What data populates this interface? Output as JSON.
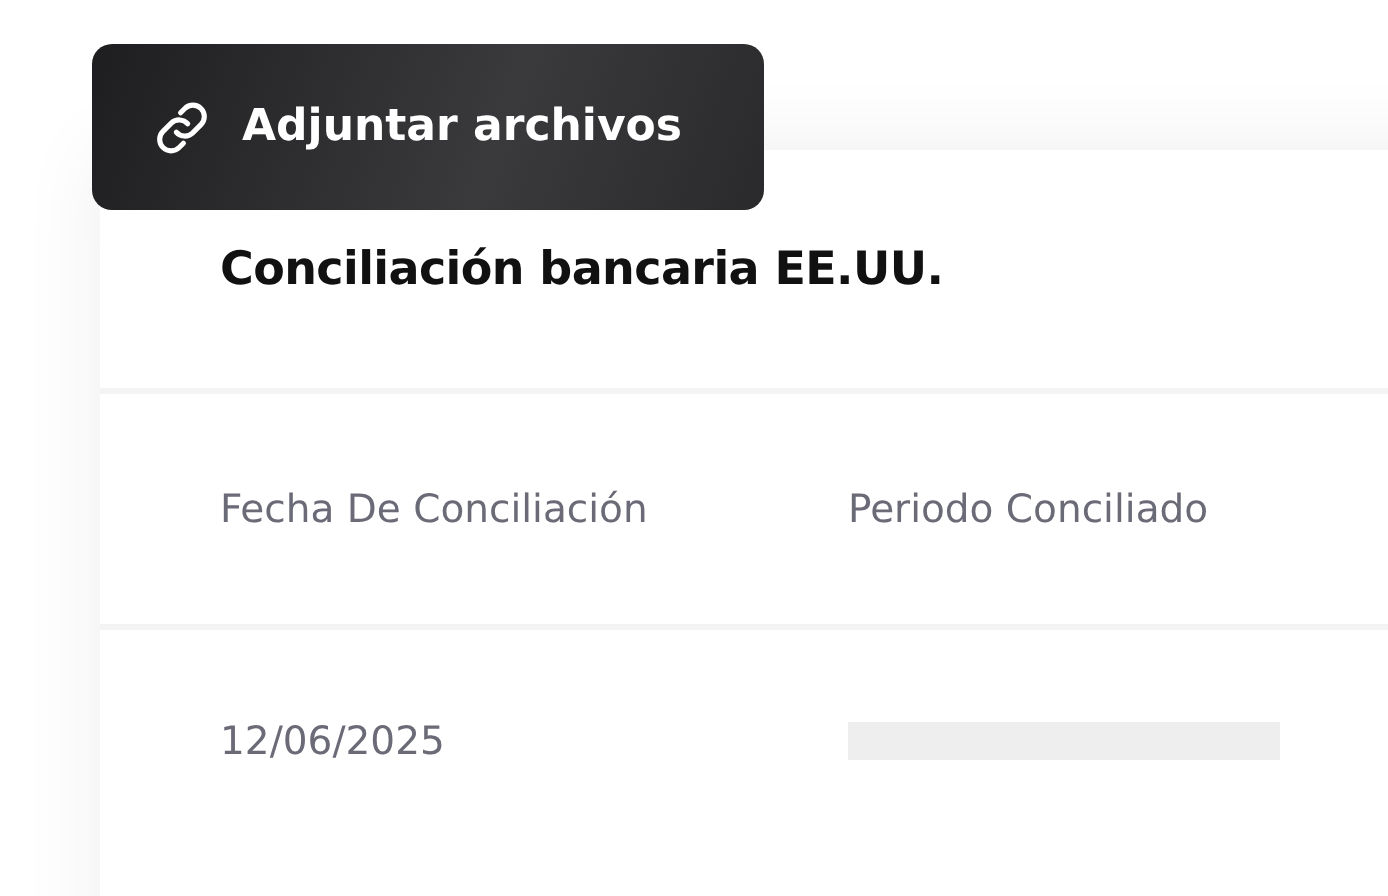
{
  "attach_button": {
    "label": "Adjuntar archivos"
  },
  "card": {
    "title": "Conciliación bancaria EE.UU.",
    "columns": [
      "Fecha De Conciliación",
      "Periodo Conciliado"
    ],
    "rows": [
      {
        "date": "12/06/2025"
      }
    ]
  }
}
